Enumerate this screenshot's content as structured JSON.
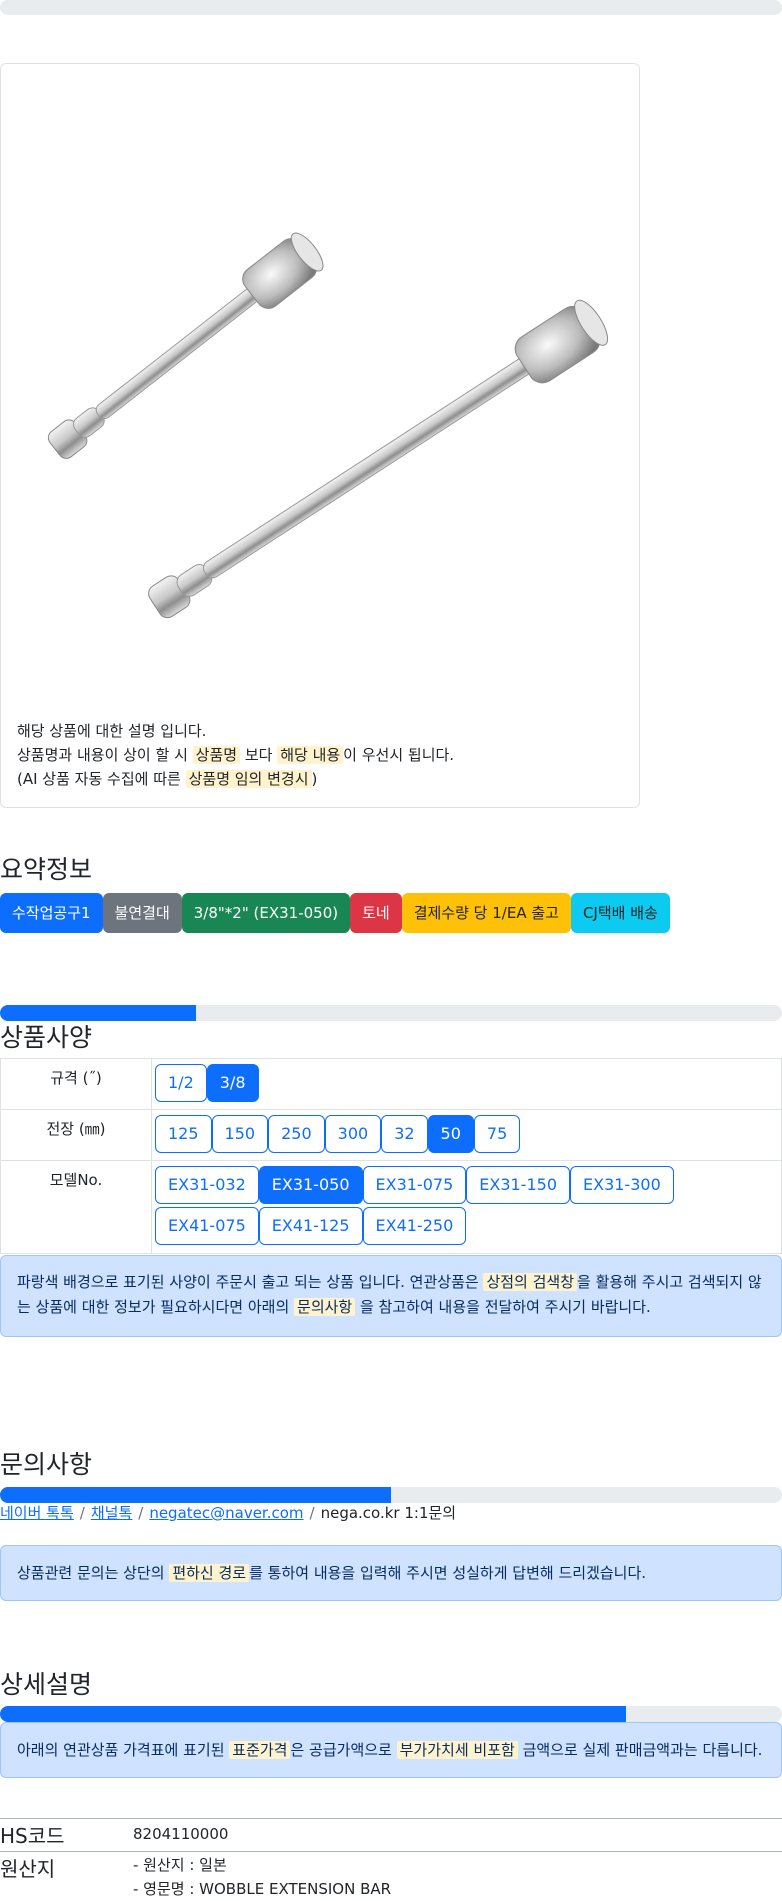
{
  "product_description": {
    "line1": "해당 상품에 대한 설명 입니다.",
    "line2_a": "상품명과 내용이 상이 할 시 ",
    "line2_hl1": "상품명",
    "line2_b": " 보다 ",
    "line2_hl2": "해당 내용",
    "line2_c": "이 우선시 됩니다.",
    "line3_a": "(AI 상품 자동 수집에 따른 ",
    "line3_hl": "상품명 임의 변경시",
    "line3_b": ")"
  },
  "summary": {
    "title": "요약정보",
    "badges": [
      "수작업공구1",
      "불연결대",
      "3/8\"*2\" (EX31-050)",
      "토네",
      "결제수량 당 1/EA 출고",
      "CJ택배 배송"
    ]
  },
  "specs": {
    "title": "상품사양",
    "progress": 0.25,
    "rows": [
      {
        "label": "규격 (˝)",
        "options": [
          "1/2",
          "3/8"
        ],
        "selected": "3/8"
      },
      {
        "label": "전장 (㎜)",
        "options": [
          "125",
          "150",
          "250",
          "300",
          "32",
          "50",
          "75"
        ],
        "selected": "50"
      },
      {
        "label": "모델No.",
        "options": [
          "EX31-032",
          "EX31-050",
          "EX31-075",
          "EX31-150",
          "EX31-300",
          "EX41-075",
          "EX41-125",
          "EX41-250"
        ],
        "selected": "EX31-050"
      }
    ],
    "notice_a": "파랑색 배경으로 표기된 사양이 주문시 출고 되는 상품 입니다. 연관상품은 ",
    "notice_hl1": "상점의 검색창",
    "notice_b": "을 활용해 주시고 검색되지 않는 상품에 대한 정보가 필요하시다면 아래의 ",
    "notice_hl2": "문의사항",
    "notice_c": " 을 참고하여 내용을 전달하여 주시기 바랍니다."
  },
  "inquiry": {
    "title": "문의사항",
    "progress": 0.5,
    "links": [
      "네이버 톡톡",
      "채널톡",
      "negatec@naver.com"
    ],
    "last": "nega.co.kr 1:1문의",
    "notice_a": "상품관련 문의는 상단의 ",
    "notice_hl": "편하신 경로",
    "notice_b": "를 통하여 내용을 입력해 주시면 성실하게 답변해 드리겠습니다."
  },
  "detail": {
    "title": "상세설명",
    "progress": 0.8,
    "notice_a": "아래의 연관상품 가격표에 표기된 ",
    "notice_hl1": "표준가격",
    "notice_b": "은 공급가액으로 ",
    "notice_hl2": "부가가치세 비포함",
    "notice_c": " 금액으로 실제 판매금액과는 다릅니다.",
    "hs_label": "HS코드",
    "hs_value": "8204110000",
    "origin_label": "원산지",
    "origin_line1": "- 원산지 : 일본",
    "origin_line2": "- 영문명 : WOBBLE EXTENSION BAR"
  },
  "colors": {
    "primary": "#0d6efd",
    "highlight": "#fff3cd",
    "alert_bg": "#cfe2ff"
  },
  "icons": [
    "product-image-extension-bars"
  ]
}
